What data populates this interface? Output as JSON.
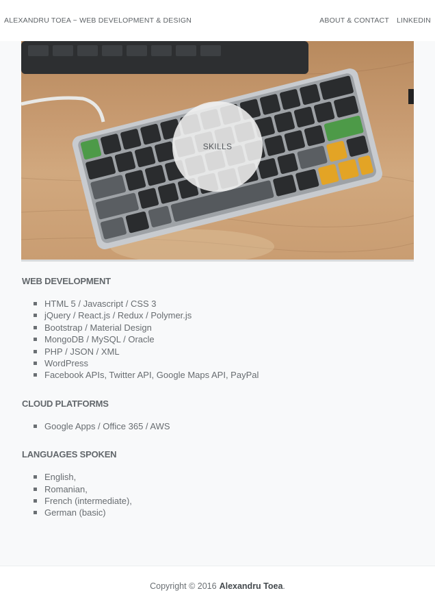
{
  "header": {
    "brand": "ALEXANDRU TOEA ~ WEB DEVELOPMENT & DESIGN",
    "nav": [
      {
        "label": "ABOUT & CONTACT"
      },
      {
        "label": "LINKEDIN"
      }
    ]
  },
  "hero": {
    "label": "SKILLS",
    "image_icon": "keyboard-photo"
  },
  "sections": [
    {
      "title": "WEB DEVELOPMENT",
      "items": [
        "HTML 5 / Javascript / CSS 3",
        "jQuery / React.js / Redux / Polymer.js",
        "Bootstrap / Material Design",
        "MongoDB / MySQL / Oracle",
        "PHP / JSON / XML",
        "WordPress",
        "Facebook APIs, Twitter API, Google Maps API, PayPal"
      ]
    },
    {
      "title": "CLOUD PLATFORMS",
      "items": [
        "Google Apps / Office 365 / AWS"
      ]
    },
    {
      "title": "LANGUAGES SPOKEN",
      "items": [
        "English,",
        "Romanian,",
        "French (intermediate),",
        "German (basic)"
      ]
    }
  ],
  "footer": {
    "copyright": "Copyright © 2016",
    "author": "Alexandru Toea",
    "suffix": "."
  },
  "colors": {
    "background": "#f8f9fa",
    "header_bg": "#ffffff",
    "text": "#555a5e",
    "accent_key_green": "#4caf50",
    "accent_key_orange": "#e8a020"
  }
}
